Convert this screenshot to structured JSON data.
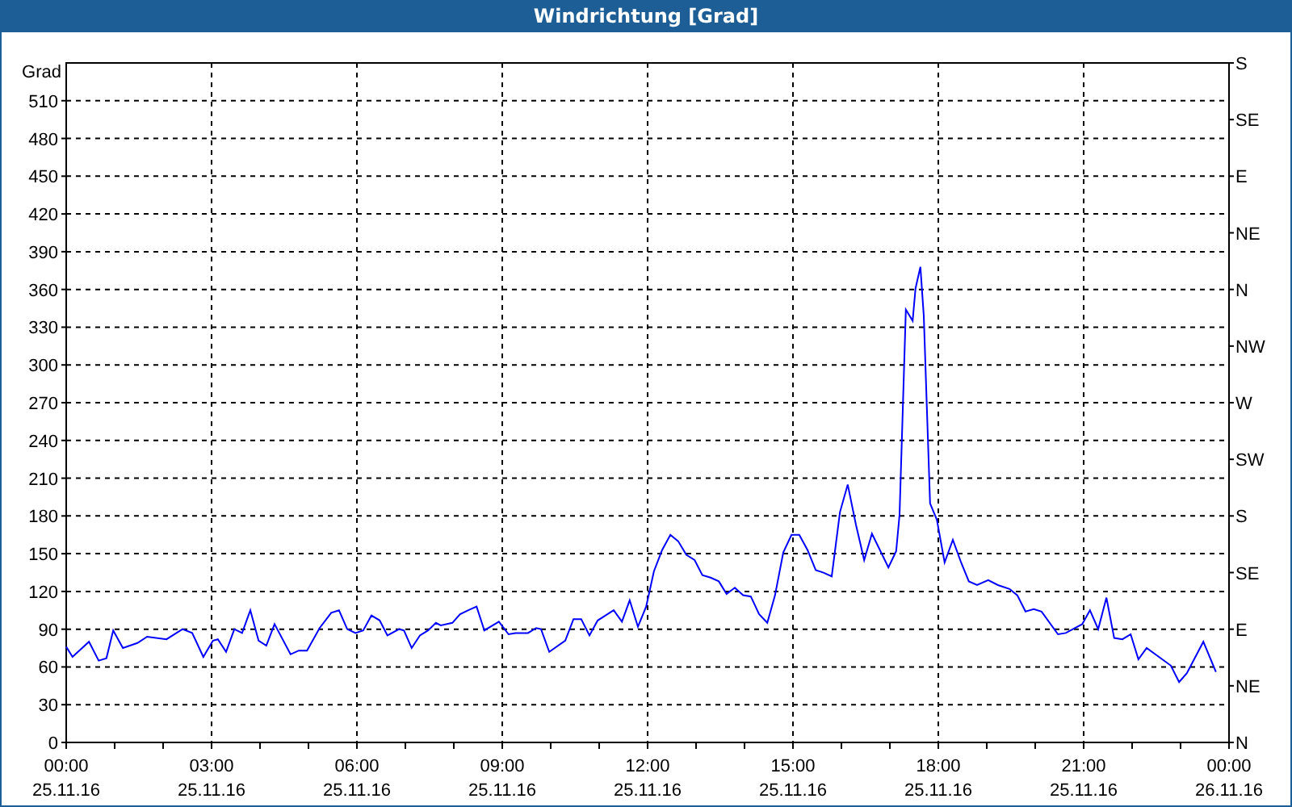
{
  "window": {
    "title": "Windrichtung [Grad]"
  },
  "chart": {
    "compass_ticks": [
      "S",
      "SE",
      "E",
      "NE",
      "N",
      "NW",
      "W",
      "SW",
      "S",
      "SE",
      "E",
      "NE",
      "N"
    ],
    "xtick_dates": [
      "25.11.16",
      "25.11.16",
      "25.11.16",
      "25.11.16",
      "25.11.16",
      "25.11.16",
      "25.11.16",
      "25.11.16",
      "26.11.16"
    ],
    "chart_data": {
      "type": "line",
      "grid": true,
      "ylabel": "Grad",
      "xlim": [
        0,
        24
      ],
      "ylim": [
        0,
        540
      ],
      "xticks": [
        {
          "value": 0,
          "label": "00:00"
        },
        {
          "value": 3,
          "label": "03:00"
        },
        {
          "value": 6,
          "label": "06:00"
        },
        {
          "value": 9,
          "label": "09:00"
        },
        {
          "value": 12,
          "label": "12:00"
        },
        {
          "value": 15,
          "label": "15:00"
        },
        {
          "value": 18,
          "label": "18:00"
        },
        {
          "value": 21,
          "label": "21:00"
        },
        {
          "value": 24,
          "label": "00:00"
        }
      ],
      "yticks": [
        0,
        30,
        60,
        90,
        120,
        150,
        180,
        210,
        240,
        270,
        300,
        330,
        360,
        390,
        420,
        450,
        480,
        510
      ],
      "x": [
        0,
        0.13,
        0.47,
        0.67,
        0.83,
        0.97,
        1.17,
        1.47,
        1.67,
        2.07,
        2.4,
        2.6,
        2.83,
        3.03,
        3.13,
        3.3,
        3.47,
        3.63,
        3.8,
        3.97,
        4.13,
        4.3,
        4.63,
        4.8,
        4.97,
        5.23,
        5.47,
        5.63,
        5.8,
        5.97,
        6.13,
        6.3,
        6.47,
        6.63,
        6.87,
        6.97,
        7.13,
        7.3,
        7.47,
        7.63,
        7.73,
        7.97,
        8.13,
        8.3,
        8.47,
        8.63,
        8.93,
        9.13,
        9.27,
        9.53,
        9.7,
        9.8,
        9.97,
        10.3,
        10.47,
        10.63,
        10.8,
        10.97,
        11.3,
        11.47,
        11.63,
        11.8,
        11.97,
        12.13,
        12.3,
        12.47,
        12.63,
        12.8,
        12.97,
        13.13,
        13.3,
        13.47,
        13.63,
        13.8,
        13.97,
        14.13,
        14.3,
        14.47,
        14.63,
        14.8,
        14.97,
        15.13,
        15.3,
        15.47,
        15.63,
        15.8,
        15.97,
        16.13,
        16.3,
        16.47,
        16.63,
        16.97,
        17.13,
        17.2,
        17.33,
        17.47,
        17.53,
        17.63,
        17.7,
        17.83,
        17.97,
        18.13,
        18.3,
        18.47,
        18.63,
        18.8,
        19.03,
        19.23,
        19.47,
        19.63,
        19.8,
        19.97,
        20.13,
        20.47,
        20.63,
        20.97,
        21.13,
        21.3,
        21.47,
        21.63,
        21.8,
        21.97,
        22.13,
        22.3,
        22.8,
        22.97,
        23.13,
        23.47,
        23.73
      ],
      "series": [
        {
          "color": "#0000ff",
          "values": [
            76,
            68,
            80,
            65,
            67,
            89,
            75,
            79,
            84,
            82,
            90,
            87,
            68,
            81,
            82,
            72,
            90,
            87,
            105,
            81,
            77,
            94,
            70,
            73,
            73,
            91,
            103,
            105,
            90,
            87,
            89,
            101,
            97,
            85,
            90,
            89,
            75,
            85,
            89,
            95,
            93,
            95,
            102,
            105,
            108,
            89,
            96,
            86,
            87,
            87,
            91,
            90,
            72,
            81,
            98,
            98,
            85,
            97,
            105,
            96,
            113,
            92,
            108,
            136,
            153,
            165,
            160,
            149,
            145,
            133,
            131,
            128,
            118,
            123,
            117,
            116,
            102,
            95,
            117,
            151,
            165,
            165,
            153,
            137,
            135,
            132,
            183,
            205,
            173,
            145,
            166,
            139,
            152,
            181,
            344,
            335,
            361,
            378,
            339,
            190,
            177,
            143,
            161,
            143,
            128,
            125,
            129,
            125,
            122,
            117,
            104,
            106,
            104,
            86,
            87,
            94,
            105,
            90,
            115,
            83,
            82,
            86,
            66,
            75,
            61,
            48,
            55,
            80,
            56
          ]
        }
      ]
    }
  }
}
